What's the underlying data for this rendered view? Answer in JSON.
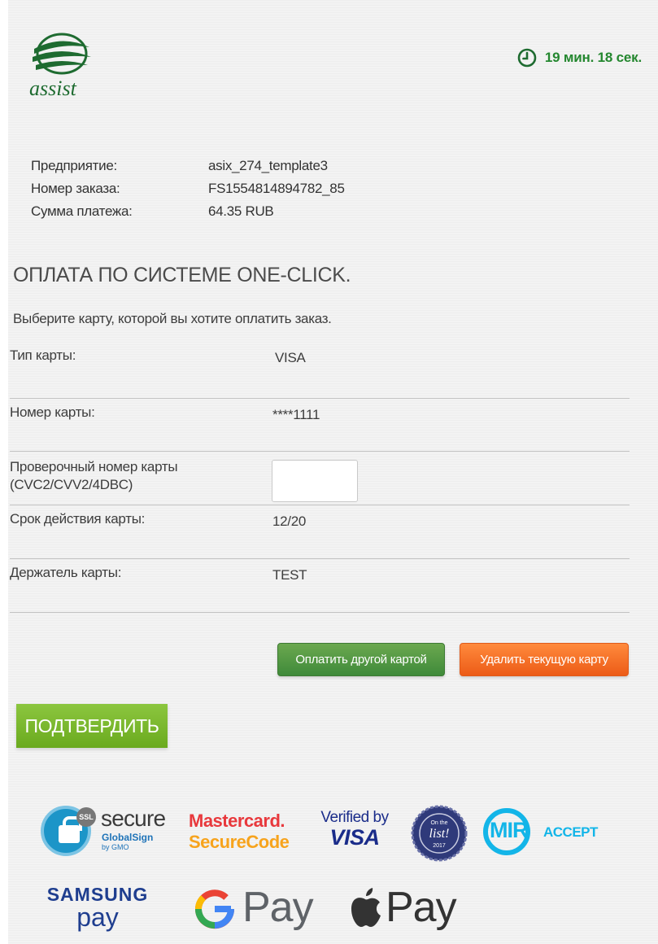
{
  "header": {
    "logo_text": "assist",
    "timer": "19 мин. 18 сек."
  },
  "order": {
    "rows": [
      {
        "label": "Предприятие:",
        "value": "asix_274_template3"
      },
      {
        "label": "Номер заказа:",
        "value": "FS1554814894782_85"
      },
      {
        "label": "Сумма платежа:",
        "value": "64.35 RUB"
      }
    ]
  },
  "payment": {
    "title": "ОПЛАТА ПО СИСТЕМЕ ONE-CLICK.",
    "subtitle": "Выберите карту, которой вы хотите оплатить заказ.",
    "card_type": {
      "label": "Тип карты:",
      "value": "VISA"
    },
    "card_number": {
      "label": "Номер карты:",
      "value": "****1111"
    },
    "cvc": {
      "label_line1": "Проверочный номер карты",
      "label_line2": "(CVC2/CVV2/4DBC)",
      "value": ""
    },
    "expiry": {
      "label": "Срок действия карты:",
      "value": "12/20"
    },
    "holder": {
      "label": "Держатель карты:",
      "value": "TEST"
    }
  },
  "buttons": {
    "other_card": "Оплатить другой картой",
    "delete_card": "Удалить текущую карту",
    "confirm": "ПОДТВЕРДИТЬ"
  },
  "badges": {
    "globalsign": {
      "ssl": "SSL",
      "secure": "secure",
      "brand": "GlobalSign",
      "by": "by GMO"
    },
    "mastercard": {
      "line1": "Mastercard.",
      "line2": "SecureCode"
    },
    "visa": {
      "line1": "Verified by",
      "line2": "VISA"
    },
    "list": {
      "top": "On the",
      "main": "list!",
      "year": "2017"
    },
    "mir": {
      "mir": "MIR",
      "accept": "ACCEPT"
    },
    "samsung": {
      "line1": "SAMSUNG",
      "line2": "pay"
    },
    "gpay": {
      "text": "Pay"
    },
    "applepay": {
      "text": "Pay"
    }
  },
  "colors": {
    "brand_green": "#24872f",
    "btn_green": "#4f973f",
    "btn_orange": "#f26a22",
    "confirm_green": "#7bb730"
  }
}
